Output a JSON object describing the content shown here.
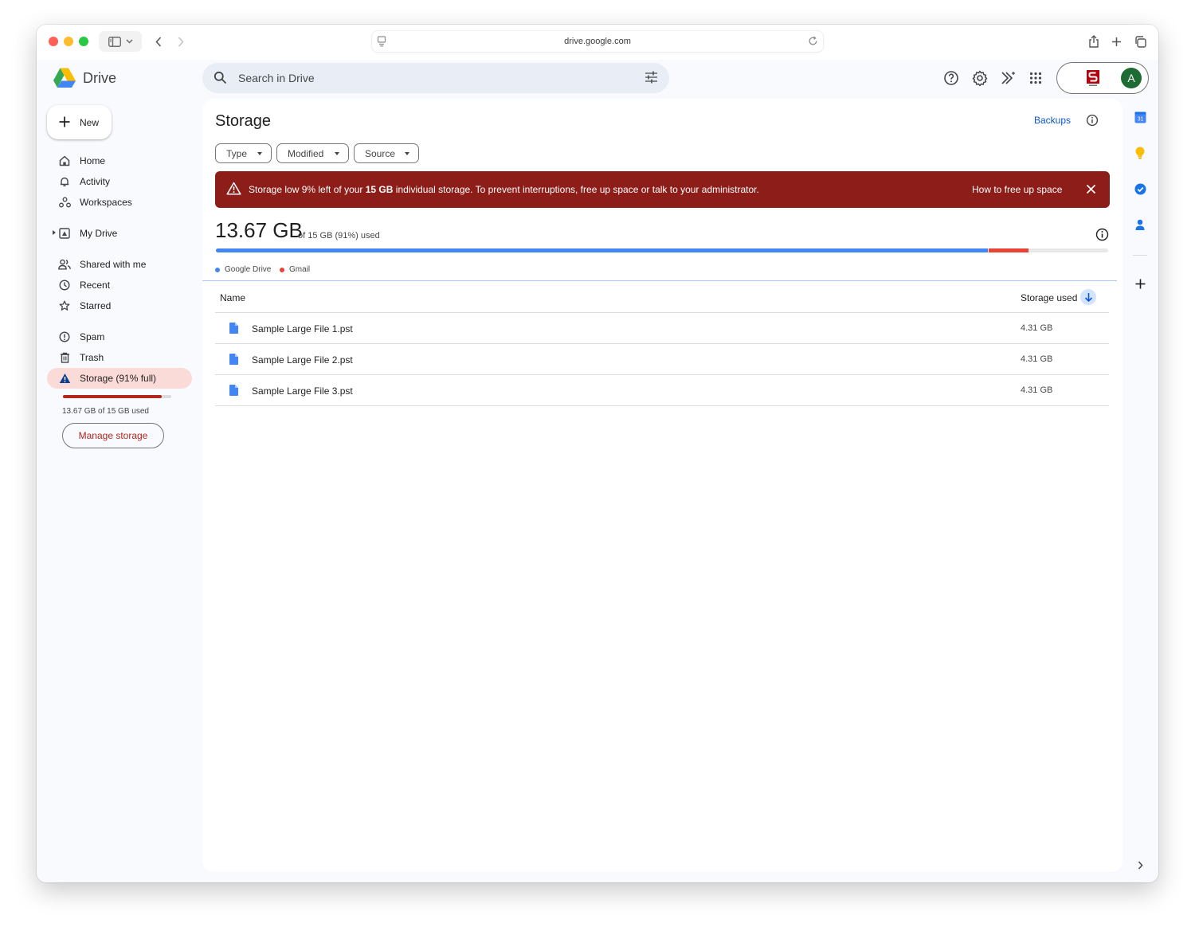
{
  "browser": {
    "url": "drive.google.com"
  },
  "app": {
    "name": "Drive"
  },
  "search": {
    "placeholder": "Search in Drive"
  },
  "account": {
    "avatar_letter": "A",
    "avatar_color": "#1e6b33"
  },
  "sidebar": {
    "new_label": "New",
    "items": [
      {
        "label": "Home",
        "icon": "home-icon"
      },
      {
        "label": "Activity",
        "icon": "bell-icon"
      },
      {
        "label": "Workspaces",
        "icon": "workspaces-icon"
      },
      {
        "label": "My Drive",
        "icon": "my-drive-icon"
      },
      {
        "label": "Shared with me",
        "icon": "people-icon"
      },
      {
        "label": "Recent",
        "icon": "clock-icon"
      },
      {
        "label": "Starred",
        "icon": "star-icon"
      },
      {
        "label": "Spam",
        "icon": "spam-icon"
      },
      {
        "label": "Trash",
        "icon": "trash-icon"
      },
      {
        "label": "Storage (91% full)",
        "icon": "warning-icon"
      }
    ],
    "storage_fraction": 0.91,
    "usage_text": "13.67 GB of 15 GB used",
    "manage_label": "Manage storage"
  },
  "main": {
    "title": "Storage",
    "backups_label": "Backups",
    "filters": [
      "Type",
      "Modified",
      "Source"
    ],
    "banner": {
      "prefix": "Storage low",
      "text_before": " 9% left of your ",
      "bold": "15 GB",
      "text_after": " individual storage. To prevent interruptions, free up space or talk to your administrator.",
      "link": "How to free up space",
      "color": "#8c1d18"
    },
    "usage": {
      "used": "13.67 GB",
      "detail": "of 15 GB (91%) used",
      "segments": [
        {
          "label": "Google Drive",
          "fraction": 0.865,
          "color": "#4285f4"
        },
        {
          "label": "Gmail",
          "fraction": 0.045,
          "color": "#ea4335"
        }
      ]
    },
    "table": {
      "col_name": "Name",
      "col_storage": "Storage used",
      "rows": [
        {
          "name": "Sample Large File 1.pst",
          "size": "4.31 GB"
        },
        {
          "name": "Sample Large File 2.pst",
          "size": "4.31 GB"
        },
        {
          "name": "Sample Large File 3.pst",
          "size": "4.31 GB"
        }
      ]
    }
  },
  "side_panel": {
    "calendar_day": "31"
  }
}
